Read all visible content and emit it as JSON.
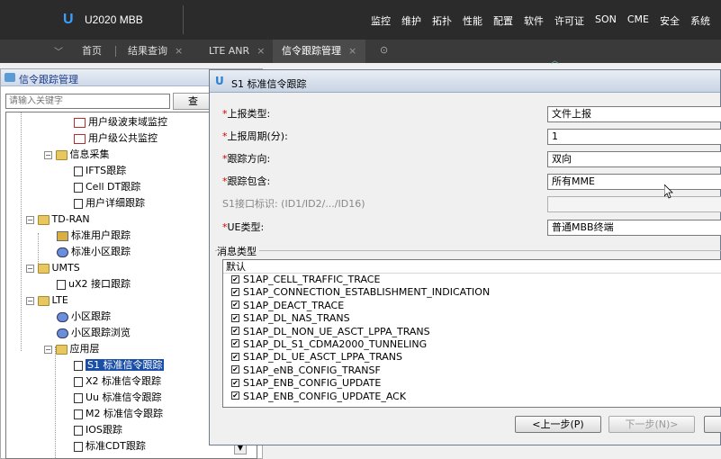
{
  "app": {
    "product": "U2020 MBB",
    "logo": "U"
  },
  "menu": [
    "监控",
    "维护",
    "拓扑",
    "性能",
    "配置",
    "软件",
    "许可证",
    "SON",
    "CME",
    "安全",
    "系统"
  ],
  "tabs": [
    {
      "label": "首页",
      "closable": false
    },
    {
      "label": "结果查询",
      "closable": true
    },
    {
      "label": "LTE ANR",
      "closable": true
    },
    {
      "label": "信令跟踪管理",
      "closable": true
    }
  ],
  "left_panel": {
    "title": "信令跟踪管理",
    "search_placeholder": "请输入关键字",
    "search_button": "查",
    "tree": [
      {
        "label": "用户级波束域监控",
        "icon": "chart-icon"
      },
      {
        "label": "用户级公共监控",
        "icon": "chart-icon"
      },
      {
        "label": "信息采集",
        "icon": "folder-icon",
        "expander": "−"
      },
      {
        "label": "IFTS跟踪",
        "icon": "plug-icon"
      },
      {
        "label": "Cell DT跟踪",
        "icon": "plug-icon"
      },
      {
        "label": "用户详细跟踪",
        "icon": "plug-icon"
      },
      {
        "label": "TD-RAN",
        "icon": "folder-icon",
        "expander": "−"
      },
      {
        "label": "标准用户跟踪",
        "icon": "user-icon"
      },
      {
        "label": "标准小区跟踪",
        "icon": "cell-icon"
      },
      {
        "label": "UMTS",
        "icon": "folder-icon",
        "expander": "−"
      },
      {
        "label": "uX2 接口跟踪",
        "icon": "plug-icon"
      },
      {
        "label": "LTE",
        "icon": "folder-icon",
        "expander": "−"
      },
      {
        "label": "小区跟踪",
        "icon": "cell-icon"
      },
      {
        "label": "小区跟踪浏览",
        "icon": "cell-icon"
      },
      {
        "label": "应用层",
        "icon": "folder-icon",
        "expander": "−"
      },
      {
        "label": "S1 标准信令跟踪",
        "icon": "plug-icon",
        "selected": true
      },
      {
        "label": "X2 标准信令跟踪",
        "icon": "plug-icon"
      },
      {
        "label": "Uu 标准信令跟踪",
        "icon": "plug-icon"
      },
      {
        "label": "M2 标准信令跟踪",
        "icon": "plug-icon"
      },
      {
        "label": "IOS跟踪",
        "icon": "plug-icon"
      },
      {
        "label": "标准CDT跟踪",
        "icon": "plug-icon"
      }
    ]
  },
  "dialog": {
    "title": "S1 标准信令跟踪",
    "fields": [
      {
        "label": "上报类型:",
        "required": true,
        "value": "文件上报"
      },
      {
        "label": "上报周期(分):",
        "required": true,
        "value": "1"
      },
      {
        "label": "跟踪方向:",
        "required": true,
        "value": "双向"
      },
      {
        "label": "跟踪包含:",
        "required": true,
        "value": "所有MME"
      },
      {
        "label": "S1接口标识: (ID1/ID2/.../ID16)",
        "required": false,
        "value": ""
      },
      {
        "label": "UE类型:",
        "required": true,
        "value": "普通MBB终端"
      }
    ],
    "message_group_label": "消息类型",
    "message_header": "默认",
    "messages": [
      "S1AP_CELL_TRAFFIC_TRACE",
      "S1AP_CONNECTION_ESTABLISHMENT_INDICATION",
      "S1AP_DEACT_TRACE",
      "S1AP_DL_NAS_TRANS",
      "S1AP_DL_NON_UE_ASCT_LPPA_TRANS",
      "S1AP_DL_S1_CDMA2000_TUNNELING",
      "S1AP_DL_UE_ASCT_LPPA_TRANS",
      "S1AP_eNB_CONFIG_TRANSF",
      "S1AP_ENB_CONFIG_UPDATE",
      "S1AP_ENB_CONFIG_UPDATE_ACK"
    ],
    "prev_button": "<上一步(P)",
    "next_button": "下一步(N)>"
  }
}
